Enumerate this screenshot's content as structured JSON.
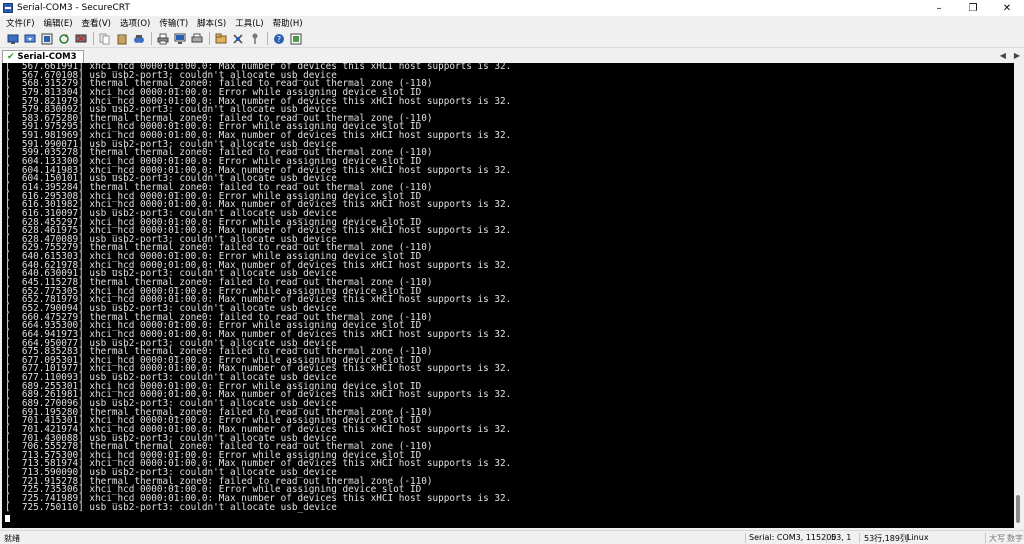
{
  "window": {
    "title": "Serial-COM3 - SecureCRT"
  },
  "menu": [
    "文件(F)",
    "编辑(E)",
    "查看(V)",
    "选项(O)",
    "传输(T)",
    "脚本(S)",
    "工具(L)",
    "帮助(H)"
  ],
  "tab": {
    "label": "Serial-COM3"
  },
  "terminal_lines": [
    "[  567.661991] xhci_hcd 0000:01:00.0: Max number of devices this xHCI host supports is 32.",
    "[  567.670108] usb usb2-port3: couldn't allocate usb_device",
    "[  568.315279] thermal thermal_zone0: failed to read out thermal zone (-110)",
    "[  579.813304] xhci_hcd 0000:01:00.0: Error while assigning device slot ID",
    "[  579.821979] xhci_hcd 0000:01:00.0: Max number of devices this xHCI host supports is 32.",
    "[  579.830092] usb usb2-port3: couldn't allocate usb_device",
    "[  583.675280] thermal thermal_zone0: failed to read out thermal zone (-110)",
    "[  591.975295] xhci_hcd 0000:01:00.0: Error while assigning device slot ID",
    "[  591.981969] xhci_hcd 0000:01:00.0: Max number of devices this xHCI host supports is 32.",
    "[  591.990071] usb usb2-port3: couldn't allocate usb_device",
    "[  599.035278] thermal thermal_zone0: failed to read out thermal zone (-110)",
    "[  604.133300] xhci_hcd 0000:01:00.0: Error while assigning device slot ID",
    "[  604.141983] xhci_hcd 0000:01:00.0: Max number of devices this xHCI host supports is 32.",
    "[  604.150101] usb usb2-port3: couldn't allocate usb_device",
    "[  614.395284] thermal thermal_zone0: failed to read out thermal zone (-110)",
    "[  616.295308] xhci_hcd 0000:01:00.0: Error while assigning device slot ID",
    "[  616.301982] xhci_hcd 0000:01:00.0: Max number of devices this xHCI host supports is 32.",
    "[  616.310097] usb usb2-port3: couldn't allocate usb_device",
    "[  628.455297] xhci_hcd 0000:01:00.0: Error while assigning device slot ID",
    "[  628.461975] xhci_hcd 0000:01:00.0: Max number of devices this xHCI host supports is 32.",
    "[  628.470089] usb usb2-port3: couldn't allocate usb_device",
    "[  629.755279] thermal thermal_zone0: failed to read out thermal zone (-110)",
    "[  640.615303] xhci_hcd 0000:01:00.0: Error while assigning device slot ID",
    "[  640.621978] xhci_hcd 0000:01:00.0: Max number of devices this xHCI host supports is 32.",
    "[  640.630091] usb usb2-port3: couldn't allocate usb_device",
    "[  645.115278] thermal thermal_zone0: failed to read out thermal zone (-110)",
    "[  652.775305] xhci_hcd 0000:01:00.0: Error while assigning device slot ID",
    "[  652.781979] xhci_hcd 0000:01:00.0: Max number of devices this xHCI host supports is 32.",
    "[  652.790094] usb usb2-port3: couldn't allocate usb_device",
    "[  660.475279] thermal thermal_zone0: failed to read out thermal zone (-110)",
    "[  664.935300] xhci_hcd 0000:01:00.0: Error while assigning device slot ID",
    "[  664.941973] xhci_hcd 0000:01:00.0: Max number of devices this xHCI host supports is 32.",
    "[  664.950077] usb usb2-port3: couldn't allocate usb_device",
    "[  675.835283] thermal thermal_zone0: failed to read out thermal zone (-110)",
    "[  677.095301] xhci_hcd 0000:01:00.0: Error while assigning device slot ID",
    "[  677.101977] xhci_hcd 0000:01:00.0: Max number of devices this xHCI host supports is 32.",
    "[  677.110093] usb usb2-port3: couldn't allocate usb_device",
    "[  689.255301] xhci_hcd 0000:01:00.0: Error while assigning device slot ID",
    "[  689.261981] xhci_hcd 0000:01:00.0: Max number of devices this xHCI host supports is 32.",
    "[  689.270096] usb usb2-port3: couldn't allocate usb_device",
    "[  691.195280] thermal thermal_zone0: failed to read out thermal zone (-110)",
    "[  701.415301] xhci_hcd 0000:01:00.0: Error while assigning device slot ID",
    "[  701.421974] xhci_hcd 0000:01:00.0: Max number of devices this xHCI host supports is 32.",
    "[  701.430088] usb usb2-port3: couldn't allocate usb_device",
    "[  706.555278] thermal thermal_zone0: failed to read out thermal zone (-110)",
    "[  713.575300] xhci_hcd 0000:01:00.0: Error while assigning device slot ID",
    "[  713.581974] xhci_hcd 0000:01:00.0: Max number of devices this xHCI host supports is 32.",
    "[  713.590090] usb usb2-port3: couldn't allocate usb_device",
    "[  721.915278] thermal thermal_zone0: failed to read out thermal zone (-110)",
    "[  725.735306] xhci_hcd 0000:01:00.0: Error while assigning device slot ID",
    "[  725.741989] xhci_hcd 0000:01:00.0: Max number of devices this xHCI host supports is 32.",
    "[  725.750110] usb usb2-port3: couldn't allocate usb_device"
  ],
  "status": {
    "ready": "就绪",
    "connection": "Serial: COM3, 115200",
    "cursor_pos": "53,  1",
    "size": "53行,189列",
    "terminal_type": "Linux",
    "caps": "大写",
    "num": "数字"
  },
  "colors": {
    "terminal_bg": "#000000",
    "terminal_fg": "#e0e0e0",
    "chrome_bg": "#f0f0f0"
  }
}
